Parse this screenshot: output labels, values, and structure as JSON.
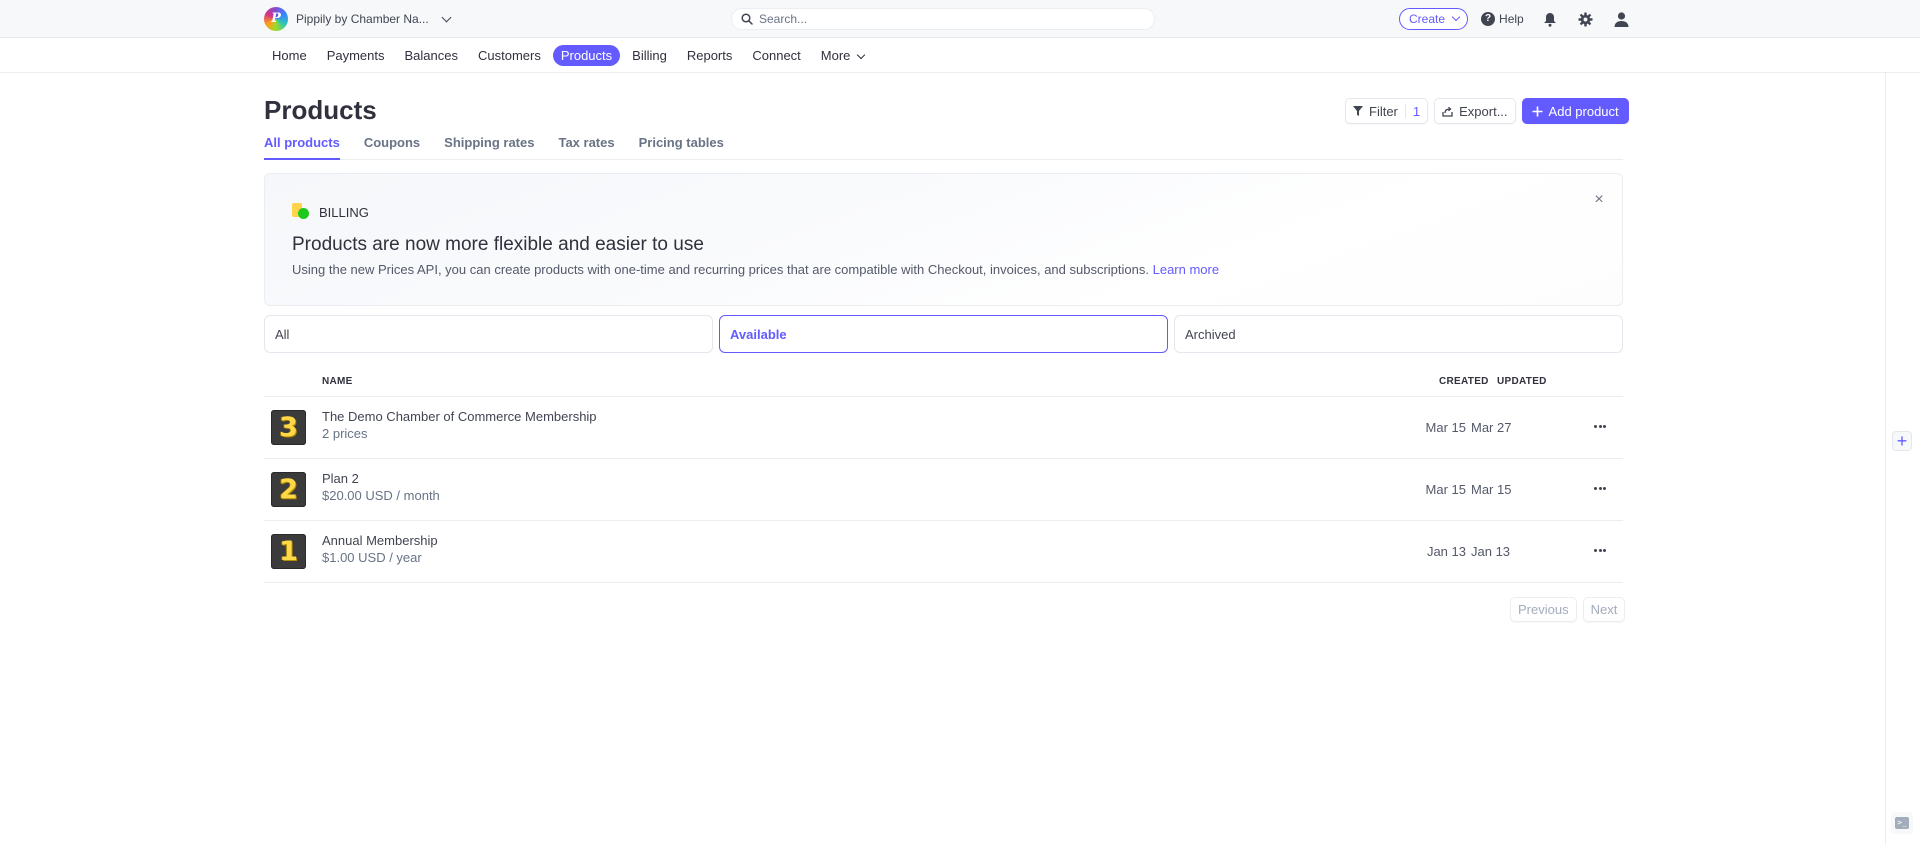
{
  "topbar": {
    "account_name": "Pippily by Chamber Na...",
    "search_placeholder": "Search...",
    "create_label": "Create",
    "help_label": "Help",
    "icons": [
      "bell-icon",
      "gear-icon",
      "user-icon"
    ]
  },
  "nav": {
    "items": [
      {
        "label": "Home",
        "active": false
      },
      {
        "label": "Payments",
        "active": false
      },
      {
        "label": "Balances",
        "active": false
      },
      {
        "label": "Customers",
        "active": false
      },
      {
        "label": "Products",
        "active": true
      },
      {
        "label": "Billing",
        "active": false
      },
      {
        "label": "Reports",
        "active": false
      },
      {
        "label": "Connect",
        "active": false
      },
      {
        "label": "More",
        "active": false
      }
    ]
  },
  "page": {
    "title": "Products",
    "actions": {
      "filter_label": "Filter",
      "filter_count": "1",
      "export_label": "Export...",
      "add_label": "Add product"
    },
    "subtabs": [
      {
        "label": "All products",
        "active": true
      },
      {
        "label": "Coupons",
        "active": false
      },
      {
        "label": "Shipping rates",
        "active": false
      },
      {
        "label": "Tax rates",
        "active": false
      },
      {
        "label": "Pricing tables",
        "active": false
      }
    ]
  },
  "banner": {
    "label": "BILLING",
    "title": "Products are now more flexible and easier to use",
    "text": "Using the new Prices API, you can create products with one-time and recurring prices that are compatible with Checkout, invoices, and subscriptions.",
    "link": "Learn more",
    "close": "×"
  },
  "filters": [
    {
      "label": "All",
      "active": false
    },
    {
      "label": "Available",
      "active": true
    },
    {
      "label": "Archived",
      "active": false
    }
  ],
  "table": {
    "headers": {
      "name": "NAME",
      "created": "CREATED",
      "updated": "UPDATED"
    },
    "rows": [
      {
        "thumb": "3",
        "name": "The Demo Chamber of Commerce Membership",
        "sub": "2 prices",
        "created": "Mar 15",
        "updated": "Mar 27"
      },
      {
        "thumb": "2",
        "name": "Plan 2",
        "sub": "$20.00 USD / month",
        "created": "Mar 15",
        "updated": "Mar 15"
      },
      {
        "thumb": "1",
        "name": "Annual Membership",
        "sub": "$1.00 USD / year",
        "created": "Jan 13",
        "updated": "Jan 13"
      }
    ]
  },
  "pagination": {
    "previous": "Previous",
    "next": "Next"
  },
  "rail": {
    "plus": "+",
    "console": ">_"
  },
  "colors": {
    "accent": "#635bff",
    "text": "#30313d",
    "muted": "#687385"
  }
}
